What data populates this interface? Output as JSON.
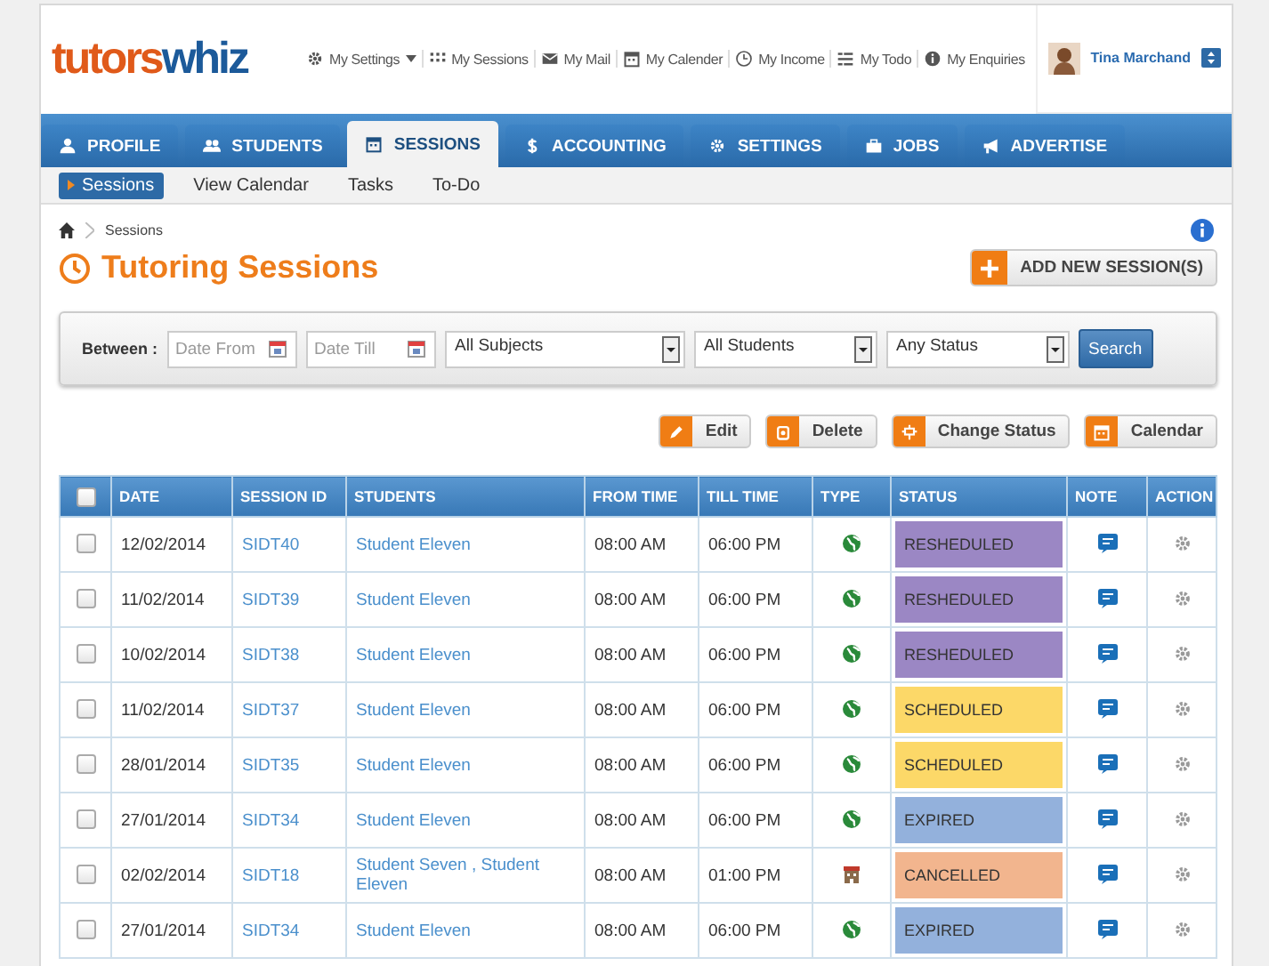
{
  "logo": {
    "first": "tutors",
    "second": "whiz"
  },
  "top_links": [
    {
      "label": "My Settings",
      "dropdown": true
    },
    {
      "label": "My Sessions",
      "dropdown": false
    },
    {
      "label": "My Mail",
      "dropdown": false
    },
    {
      "label": "My Calender",
      "dropdown": false
    },
    {
      "label": "My Income",
      "dropdown": false
    },
    {
      "label": "My Todo",
      "dropdown": false
    },
    {
      "label": "My Enquiries",
      "dropdown": false
    }
  ],
  "user": {
    "name": "Tina Marchand"
  },
  "tabs": [
    {
      "label": "PROFILE",
      "selected": false
    },
    {
      "label": "STUDENTS",
      "selected": false
    },
    {
      "label": "SESSIONS",
      "selected": true
    },
    {
      "label": "ACCOUNTING",
      "selected": false
    },
    {
      "label": "SETTINGS",
      "selected": false
    },
    {
      "label": "JOBS",
      "selected": false
    },
    {
      "label": "ADVERTISE",
      "selected": false
    }
  ],
  "subnav": [
    {
      "label": "Sessions",
      "selected": true
    },
    {
      "label": "View Calendar",
      "selected": false
    },
    {
      "label": "Tasks",
      "selected": false
    },
    {
      "label": "To-Do",
      "selected": false
    }
  ],
  "breadcrumb": [
    "Sessions"
  ],
  "page_title": "Tutoring Sessions",
  "add_button": "ADD NEW SESSION(S)",
  "filters": {
    "label": "Between :",
    "date_from": {
      "placeholder": "Date From"
    },
    "date_till": {
      "placeholder": "Date Till"
    },
    "selects": [
      "All Subjects",
      "All Students",
      "Any Status"
    ],
    "search_button": "Search"
  },
  "actions": [
    "Edit",
    "Delete",
    "Change Status",
    "Calendar"
  ],
  "table": {
    "columns": [
      "DATE",
      "SESSION ID",
      "STUDENTS",
      "FROM TIME",
      "TILL TIME",
      "TYPE",
      "STATUS",
      "NOTE",
      "ACTION"
    ],
    "header_checked": false,
    "rows": [
      {
        "checked": false,
        "date": "12/02/2014",
        "session_id": "SIDT40",
        "students": "Student Eleven",
        "from": "08:00 AM",
        "till": "06:00 PM",
        "kind": "online",
        "status": "RESHEDULED",
        "color": "#9b87c4"
      },
      {
        "checked": false,
        "date": "11/02/2014",
        "session_id": "SIDT39",
        "students": "Student Eleven",
        "from": "08:00 AM",
        "till": "06:00 PM",
        "kind": "online",
        "status": "RESHEDULED",
        "color": "#9b87c4"
      },
      {
        "checked": false,
        "date": "10/02/2014",
        "session_id": "SIDT38",
        "students": "Student Eleven",
        "from": "08:00 AM",
        "till": "06:00 PM",
        "kind": "online",
        "status": "RESHEDULED",
        "color": "#9b87c4"
      },
      {
        "checked": false,
        "date": "11/02/2014",
        "session_id": "SIDT37",
        "students": "Student Eleven",
        "from": "08:00 AM",
        "till": "06:00 PM",
        "kind": "online",
        "status": "SCHEDULED",
        "color": "#fcd868"
      },
      {
        "checked": false,
        "date": "28/01/2014",
        "session_id": "SIDT35",
        "students": "Student Eleven",
        "from": "08:00 AM",
        "till": "06:00 PM",
        "kind": "online",
        "status": "SCHEDULED",
        "color": "#fcd868"
      },
      {
        "checked": false,
        "date": "27/01/2014",
        "session_id": "SIDT34",
        "students": "Student Eleven",
        "from": "08:00 AM",
        "till": "06:00 PM",
        "kind": "online",
        "status": "EXPIRED",
        "color": "#93b1dc"
      },
      {
        "checked": false,
        "date": "02/02/2014",
        "session_id": "SIDT18",
        "students": "Student Seven , Student Eleven",
        "from": "08:00 AM",
        "till": "01:00 PM",
        "kind": "venue",
        "status": "CANCELLED",
        "color": "#f2b58e"
      },
      {
        "checked": false,
        "date": "27/01/2014",
        "session_id": "SIDT34",
        "students": "Student Eleven",
        "from": "08:00 AM",
        "till": "06:00 PM",
        "kind": "online",
        "status": "EXPIRED",
        "color": "#93b1dc"
      }
    ]
  }
}
